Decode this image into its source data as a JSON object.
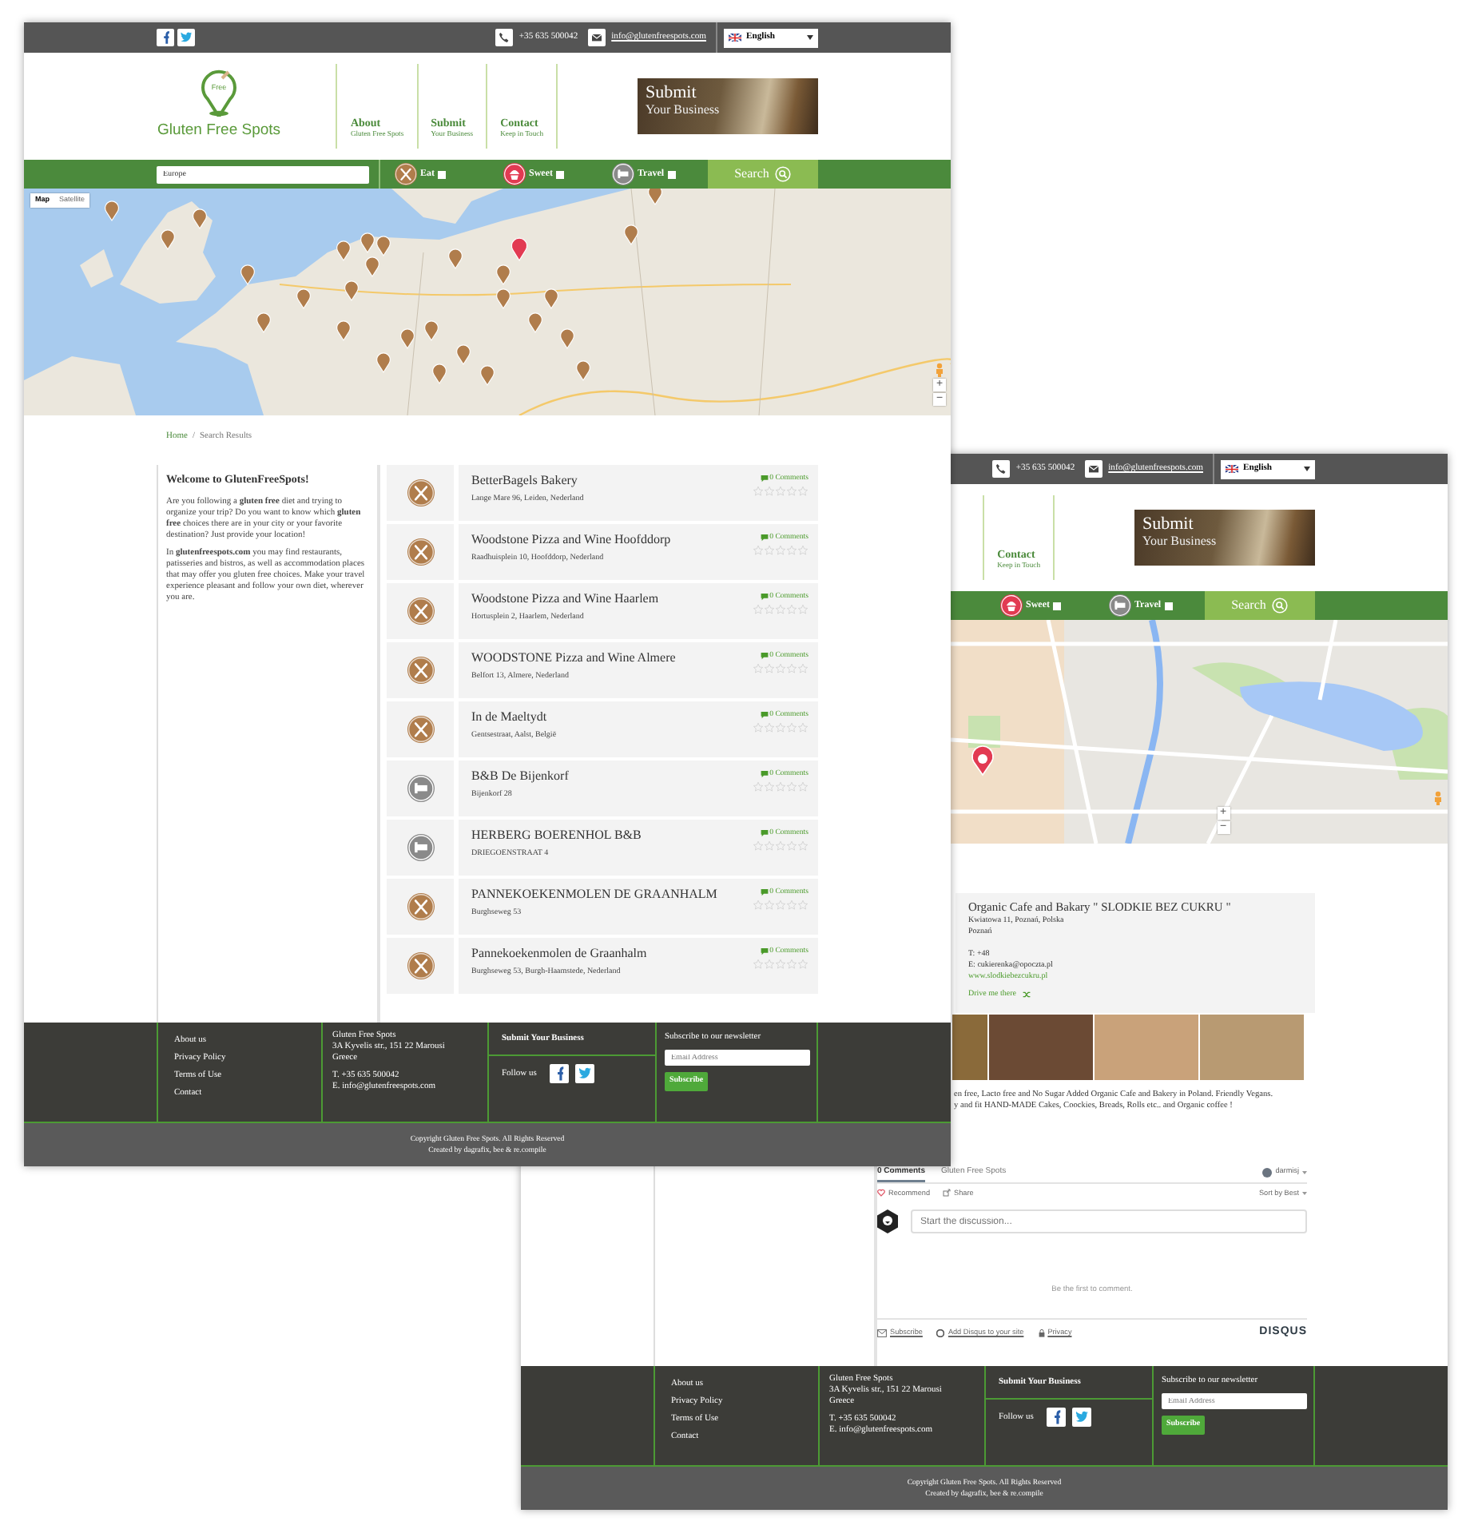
{
  "front_window": {
    "top_bar": {
      "social": [
        {
          "kind": "facebook"
        },
        {
          "kind": "twitter"
        }
      ],
      "phone": "+35 635 500042",
      "email": "info@glutenfreespots.com",
      "language": "English"
    },
    "logo": {
      "mark": "Free",
      "name": "Gluten Free Spots"
    },
    "nav": [
      {
        "title": "About",
        "subtitle": "Gluten Free Spots"
      },
      {
        "title": "Submit",
        "subtitle": "Your Business"
      },
      {
        "title": "Contact",
        "subtitle": "Keep in Touch"
      }
    ],
    "banner": {
      "title": "Submit",
      "subtitle": "Your Business"
    },
    "search_bar": {
      "location": "Europe",
      "filters": [
        {
          "kind": "eat",
          "label": "Eat",
          "checked": false
        },
        {
          "kind": "sweet",
          "label": "Sweet",
          "checked": false
        },
        {
          "kind": "travel",
          "label": "Travel",
          "checked": false
        }
      ],
      "button": "Search"
    },
    "map": {
      "kind": "europe",
      "type_buttons": [
        {
          "label": "Map",
          "selected": true
        },
        {
          "label": "Satellite",
          "selected": false
        }
      ],
      "zoom_buttons": [
        "+",
        "−"
      ]
    },
    "breadcrumb": {
      "items": [
        "Home",
        "Search Results"
      ],
      "separator": "/"
    },
    "welcome": {
      "title": "Welcome to GlutenFreeSpots!",
      "paragraphs": [
        "Are you following a **gluten free** diet and trying to organize your trip? Do you want to know which **gluten free** choices there are in your city or your favorite destination? Just provide your location!",
        "In **glutenfreespots.com** you may find restaurants, patisseries and bistros, as well as accommodation places that may offer you gluten free choices. Make your travel experience pleasant and follow your own diet, wherever you are."
      ]
    },
    "results": [
      {
        "kind": "eat",
        "name": "BetterBagels Bakery",
        "address": "Lange Mare 96, Leiden, Nederland",
        "comments": "0 Comments",
        "stars": 0
      },
      {
        "kind": "eat",
        "name": "Woodstone Pizza and Wine Hoofddorp",
        "address": "Raadhuisplein 10, Hoofddorp, Nederland",
        "comments": "0 Comments",
        "stars": 0
      },
      {
        "kind": "eat",
        "name": "Woodstone Pizza and Wine Haarlem",
        "address": "Hortusplein 2, Haarlem, Nederland",
        "comments": "0 Comments",
        "stars": 0
      },
      {
        "kind": "eat",
        "name": "WOODSTONE Pizza and Wine Almere",
        "address": "Belfort 13, Almere, Nederland",
        "comments": "0 Comments",
        "stars": 0
      },
      {
        "kind": "eat",
        "name": "In de Maeltydt",
        "address": "Gentsestraat, Aalst, België",
        "comments": "0 Comments",
        "stars": 0
      },
      {
        "kind": "travel",
        "name": "B&B De Bijenkorf",
        "address": "Bijenkorf 28",
        "comments": "0 Comments",
        "stars": 0
      },
      {
        "kind": "travel",
        "name": "HERBERG BOERENHOL B&B",
        "address": "DRIEGOENSTRAAT 4",
        "comments": "0 Comments",
        "stars": 0
      },
      {
        "kind": "eat",
        "name": "PANNEKOEKENMOLEN DE GRAANHALM",
        "address": "Burghseweg 53",
        "comments": "0 Comments",
        "stars": 0
      },
      {
        "kind": "eat",
        "name": "Pannekoekenmolen de Graanhalm",
        "address": "Burghseweg 53, Burgh-Haamstede, Nederland",
        "comments": "0 Comments",
        "stars": 0
      }
    ],
    "footer": {
      "links": [
        "About us",
        "Privacy Policy",
        "Terms of Use",
        "Contact"
      ],
      "address": [
        "Gluten Free Spots",
        "3A Kyvelis str., 151 22 Marousi",
        "Greece"
      ],
      "contact": [
        "T. +35 635 500042",
        "E. info@glutenfreespots.com"
      ],
      "submit": "Submit Your Business",
      "follow": "Follow us",
      "social": [
        {
          "kind": "facebook"
        },
        {
          "kind": "twitter"
        }
      ],
      "newsletter_title": "Subscribe to our newsletter",
      "email_placeholder": "Email Address",
      "subscribe_button": "Subscribe"
    },
    "copyright": [
      "Copyright Gluten Free Spots. All Rights Reserved",
      "Created by dagrafix, bee & re.compile"
    ]
  },
  "back_window": {
    "top_bar": {
      "phone": "+35 635 500042",
      "email": "info@glutenfreespots.com",
      "language": "English"
    },
    "nav": [
      {
        "title": "Contact",
        "subtitle": "Keep in Touch"
      }
    ],
    "banner": {
      "title": "Submit",
      "subtitle": "Your Business"
    },
    "search_bar": {
      "filters": [
        {
          "kind": "sweet",
          "label": "Sweet",
          "checked": false
        },
        {
          "kind": "travel",
          "label": "Travel",
          "checked": false
        }
      ],
      "button": "Search"
    },
    "map": {
      "kind": "city",
      "zoom_buttons": [
        "+",
        "−"
      ]
    },
    "place": {
      "name": "Organic Cafe and Bakary \" SLODKIE BEZ CUKRU \"",
      "address": [
        "Kwiatowa 11, Poznań, Polska",
        "Poznań"
      ],
      "phone": "T: +48",
      "email": "E: cukierenka@opoczta.pl",
      "website": "www.slodkiebezcukru.pl",
      "directions": "Drive me there",
      "photos": [
        {
          "kind": "partial"
        },
        {
          "kind": "full"
        },
        {
          "kind": "full"
        },
        {
          "kind": "full"
        }
      ],
      "description_lines": [
        "en free, Lacto free and No Sugar Added Organic Cafe and Bakery in Poland. Friendly Vegans.",
        "y and fit HAND-MADE Cakes, Coockies, Breads, Rolls etc.. and Organic coffee !"
      ]
    },
    "comments": {
      "tabs": [
        {
          "label": "0 Comments",
          "selected": true
        },
        {
          "label": "Gluten Free Spots",
          "selected": false
        }
      ],
      "user": "darmisj",
      "actions": [
        {
          "kind": "recommend",
          "label": "Recommend"
        },
        {
          "kind": "share",
          "label": "Share"
        }
      ],
      "sort": "Sort by Best",
      "placeholder": "Start the discussion...",
      "empty": "Be the first to comment.",
      "footer_links": [
        {
          "kind": "subscribe",
          "label": "Subscribe"
        },
        {
          "kind": "add",
          "label": "Add Disqus to your site"
        },
        {
          "kind": "privacy",
          "label": "Privacy"
        }
      ],
      "brand": "DISQUS"
    },
    "footer": {
      "links": [
        "About us",
        "Privacy Policy",
        "Terms of Use",
        "Contact"
      ],
      "address": [
        "Gluten Free Spots",
        "3A Kyvelis str., 151 22 Marousi",
        "Greece"
      ],
      "contact": [
        "T. +35 635 500042",
        "E. info@glutenfreespots.com"
      ],
      "submit": "Submit Your Business",
      "follow": "Follow us",
      "social": [
        {
          "kind": "facebook"
        },
        {
          "kind": "twitter"
        }
      ],
      "newsletter_title": "Subscribe to our newsletter",
      "email_placeholder": "Email Address",
      "subscribe_button": "Subscribe"
    },
    "copyright": [
      "Copyright Gluten Free Spots. All Rights Reserved",
      "Created by dagrafix, bee & re.compile"
    ]
  }
}
